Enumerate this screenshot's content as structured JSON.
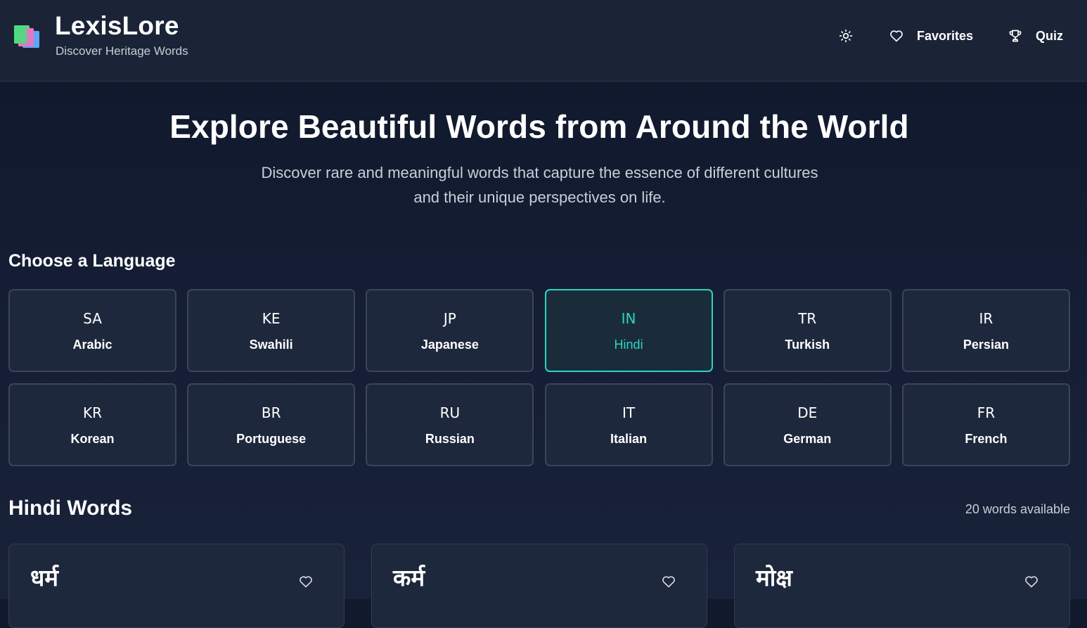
{
  "brand": {
    "title": "LexisLore",
    "subtitle": "Discover Heritage Words",
    "logo_icon": "book-stack-icon"
  },
  "nav": {
    "theme_icon": "sun-icon",
    "favorites_label": "Favorites",
    "favorites_icon": "heart-icon",
    "quiz_label": "Quiz",
    "quiz_icon": "trophy-icon"
  },
  "hero": {
    "title": "Explore Beautiful Words from Around the World",
    "subtitle": "Discover rare and meaningful words that capture the essence of different cultures and their unique perspectives on life."
  },
  "languages": {
    "heading": "Choose a Language",
    "items": [
      {
        "code": "SA",
        "name": "Arabic",
        "active": false
      },
      {
        "code": "KE",
        "name": "Swahili",
        "active": false
      },
      {
        "code": "JP",
        "name": "Japanese",
        "active": false
      },
      {
        "code": "IN",
        "name": "Hindi",
        "active": true
      },
      {
        "code": "TR",
        "name": "Turkish",
        "active": false
      },
      {
        "code": "IR",
        "name": "Persian",
        "active": false
      },
      {
        "code": "KR",
        "name": "Korean",
        "active": false
      },
      {
        "code": "BR",
        "name": "Portuguese",
        "active": false
      },
      {
        "code": "RU",
        "name": "Russian",
        "active": false
      },
      {
        "code": "IT",
        "name": "Italian",
        "active": false
      },
      {
        "code": "DE",
        "name": "German",
        "active": false
      },
      {
        "code": "FR",
        "name": "French",
        "active": false
      }
    ]
  },
  "words": {
    "heading": "Hindi Words",
    "count_label": "20 words available",
    "items": [
      {
        "word": "धर्म"
      },
      {
        "word": "कर्म"
      },
      {
        "word": "मोक्ष"
      }
    ]
  },
  "colors": {
    "accent": "#2dd4bf",
    "background": "#111a2c",
    "card": "#1e283c",
    "header": "#1b2436"
  }
}
